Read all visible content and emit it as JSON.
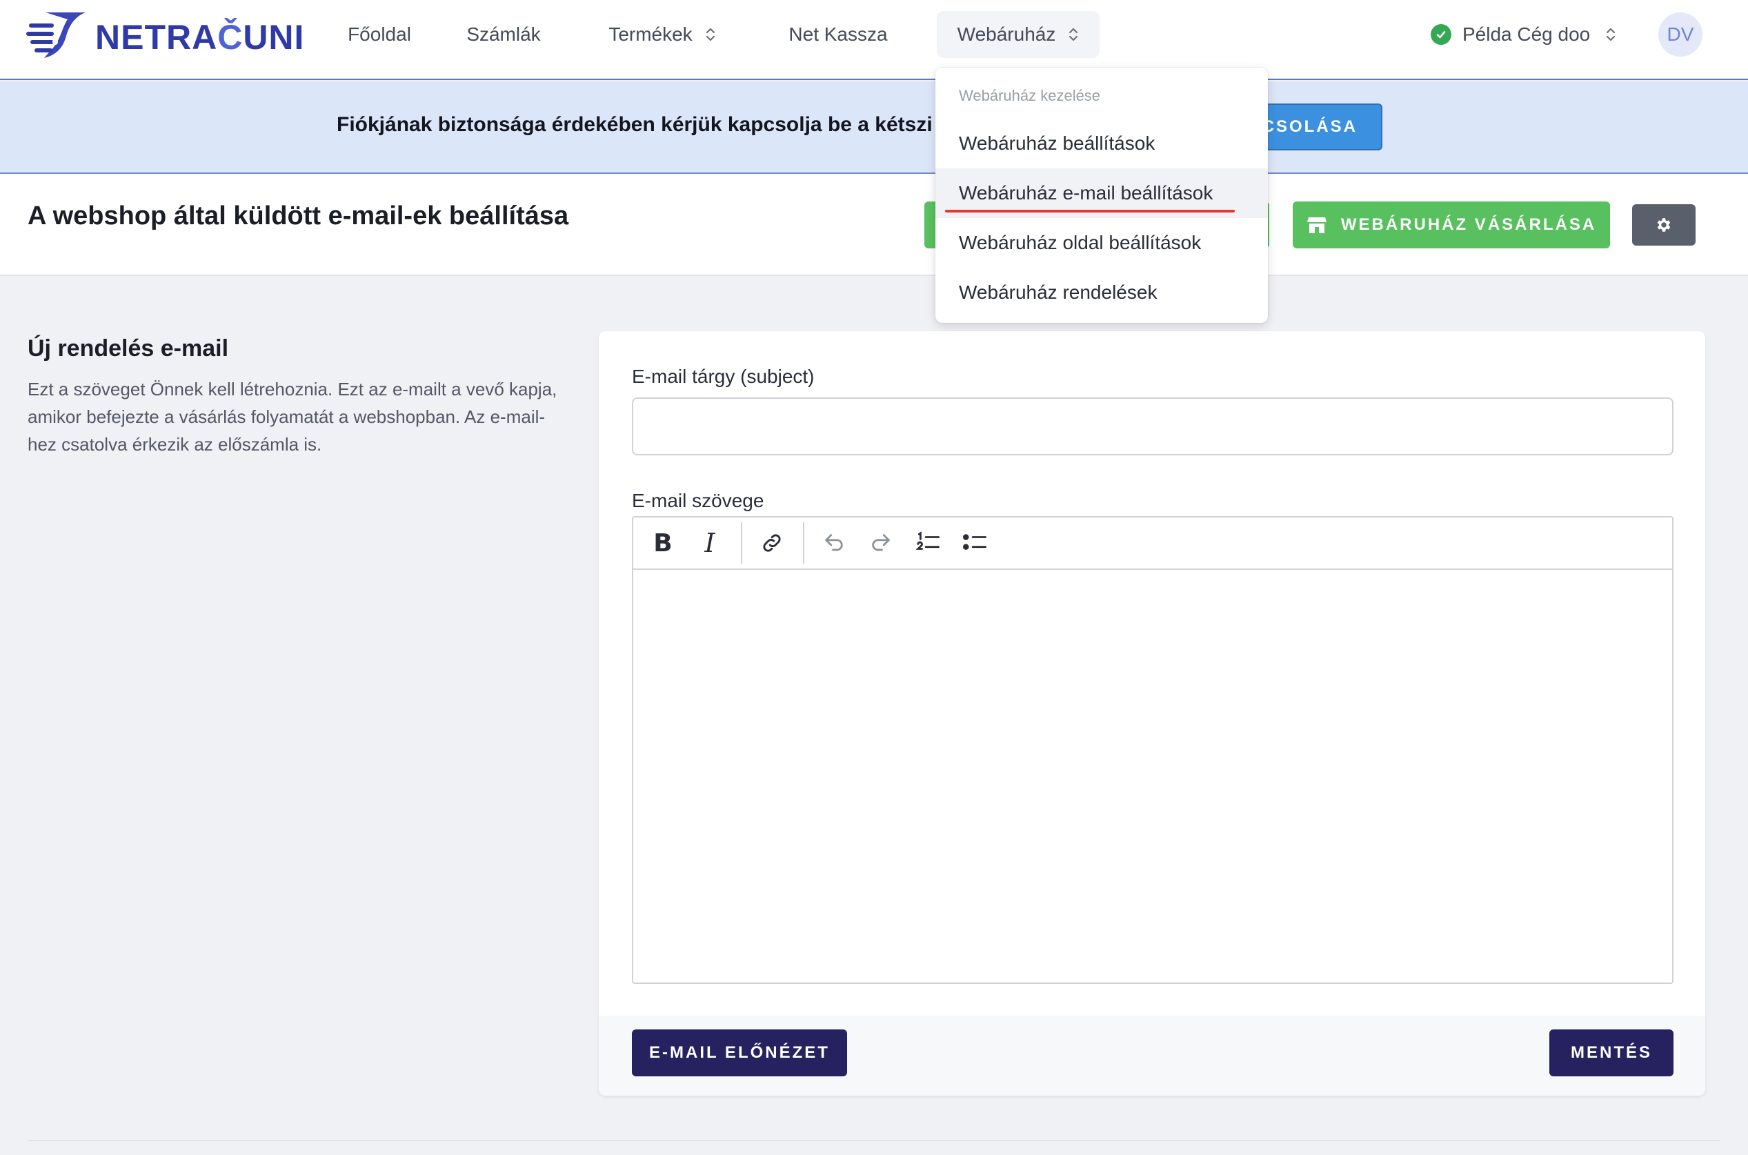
{
  "brand": {
    "name_part1": "NETRA",
    "name_part2": "Č",
    "name_part3": "UNI"
  },
  "nav": {
    "items": [
      {
        "label": "Főoldal"
      },
      {
        "label": "Számlák"
      },
      {
        "label": "Termékek"
      },
      {
        "label": "Net Kassza"
      },
      {
        "label": "Webáruház"
      }
    ]
  },
  "company": {
    "name": "Példa Cég doo",
    "status_color": "#34a853"
  },
  "user": {
    "initials": "DV"
  },
  "banner": {
    "text": "Fiókjának biztonsága érdekében kérjük kapcsolja be a kétszi",
    "button_label": "CSOLÁSA"
  },
  "page": {
    "title": "A webshop által küldött e-mail-ek beállítása",
    "buy_button_label": "WEBÁRUHÁZ VÁSÁRLÁSA",
    "buy_button_color": "#58c05f"
  },
  "section": {
    "title": "Új rendelés e-mail",
    "description": "Ezt a szöveget Önnek kell létrehoznia. Ezt az e-mailt a vevő kapja, amikor befejezte a vásárlás folyamatát a webshopban. Az e-mail-hez csatolva érkezik az előszámla is."
  },
  "form": {
    "subject_label": "E-mail tárgy (subject)",
    "subject_value": "",
    "body_label": "E-mail szövege",
    "preview_button_label": "E-MAIL ELŐNÉZET",
    "save_button_label": "MENTÉS",
    "button_color": "#25225f"
  },
  "dropdown": {
    "heading": "Webáruház kezelése",
    "items": [
      {
        "label": "Webáruház beállítások"
      },
      {
        "label": "Webáruház e-mail beállítások"
      },
      {
        "label": "Webáruház oldal beállítások"
      },
      {
        "label": "Webáruház rendelések"
      }
    ]
  },
  "icons": {
    "logo": "netracuni-logo-icon",
    "chevron": "chevron-up-down-icon",
    "check": "check-circle-icon",
    "store": "store-icon",
    "gear": "gear-icon",
    "toolbar": [
      "bold-icon",
      "italic-icon",
      "link-icon",
      "undo-icon",
      "redo-icon",
      "ordered-list-icon",
      "bullet-list-icon"
    ]
  }
}
